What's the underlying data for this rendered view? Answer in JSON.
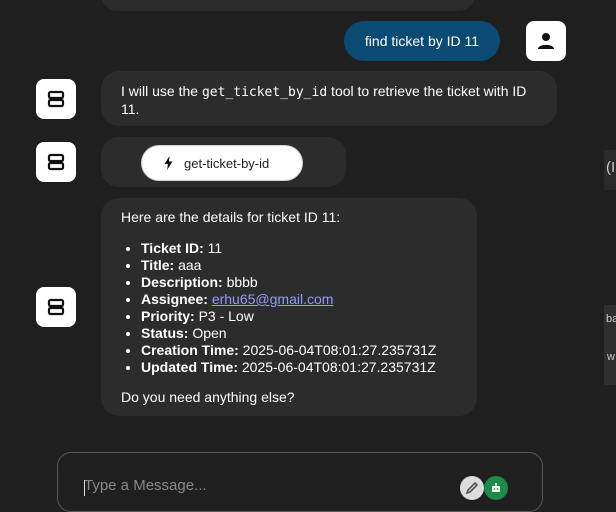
{
  "chat": {
    "user_message": "find ticket by ID 11",
    "assistant_intro_pre": "I will use the ",
    "assistant_intro_code": "get_ticket_by_id",
    "assistant_intro_post": " tool to retrieve the ticket with ID 11.",
    "tool_call_label": "get-ticket-by-id",
    "details_heading": "Here are the details for ticket ID 11:",
    "ticket": {
      "id_label": "Ticket ID:",
      "id": "11",
      "title_label": "Title:",
      "title": "aaa",
      "description_label": "Description:",
      "description": "bbbb",
      "assignee_label": "Assignee:",
      "assignee": "erhu65@gmail.com",
      "priority_label": "Priority:",
      "priority": "P3 - Low",
      "status_label": "Status:",
      "status": "Open",
      "creation_label": "Creation Time:",
      "creation": "2025-06-04T08:01:27.235731Z",
      "updated_label": "Updated Time:",
      "updated": "2025-06-04T08:01:27.235731Z"
    },
    "followup": "Do you need anything else?"
  },
  "composer": {
    "placeholder": "Type a Message..."
  },
  "side_panel": {
    "text_a": "(I",
    "text_b": "ba",
    "text_c": "w"
  },
  "colors": {
    "background": "#1f1f1f",
    "bubble": "#2c2c2c",
    "user_bubble": "#0b4a72",
    "link": "#8f9cff",
    "send_button": "#1e8a4a"
  },
  "icons": {
    "user_avatar": "person-icon",
    "bot_avatar": "robot-icon",
    "tool": "lightning-icon",
    "attach": "pen-icon",
    "send": "robot-icon"
  }
}
